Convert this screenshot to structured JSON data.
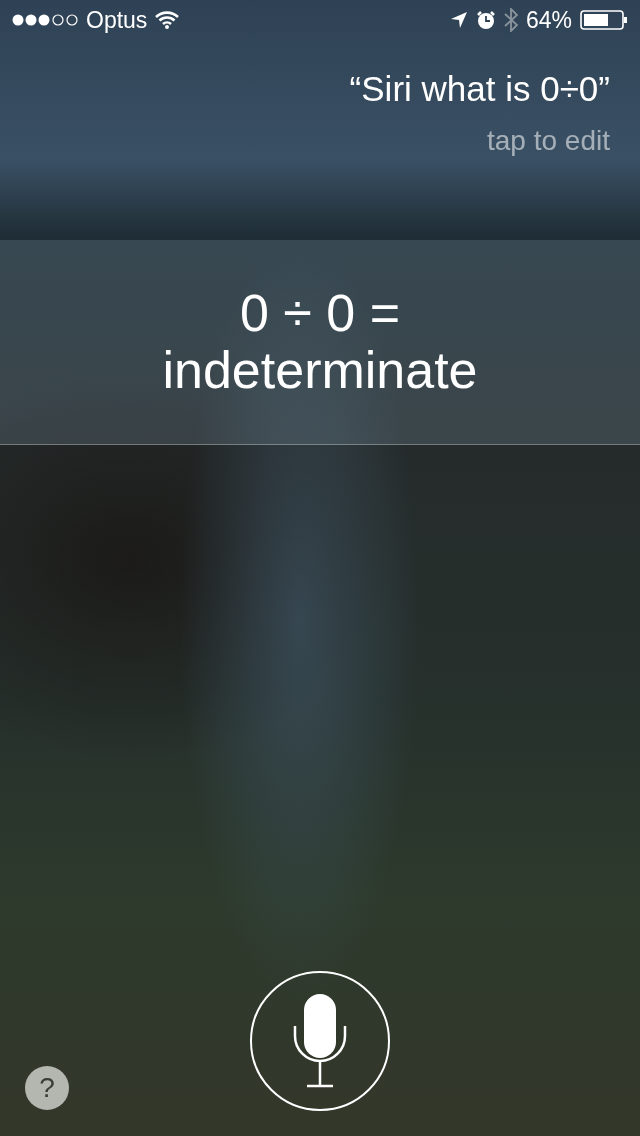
{
  "status_bar": {
    "carrier": "Optus",
    "battery_text": "64%"
  },
  "query": {
    "text": "“Siri what is 0÷0”",
    "hint": "tap to edit"
  },
  "answer": {
    "lines": [
      "0 ÷ 0 =",
      "indeterminate"
    ]
  },
  "help_button": {
    "label": "?"
  }
}
